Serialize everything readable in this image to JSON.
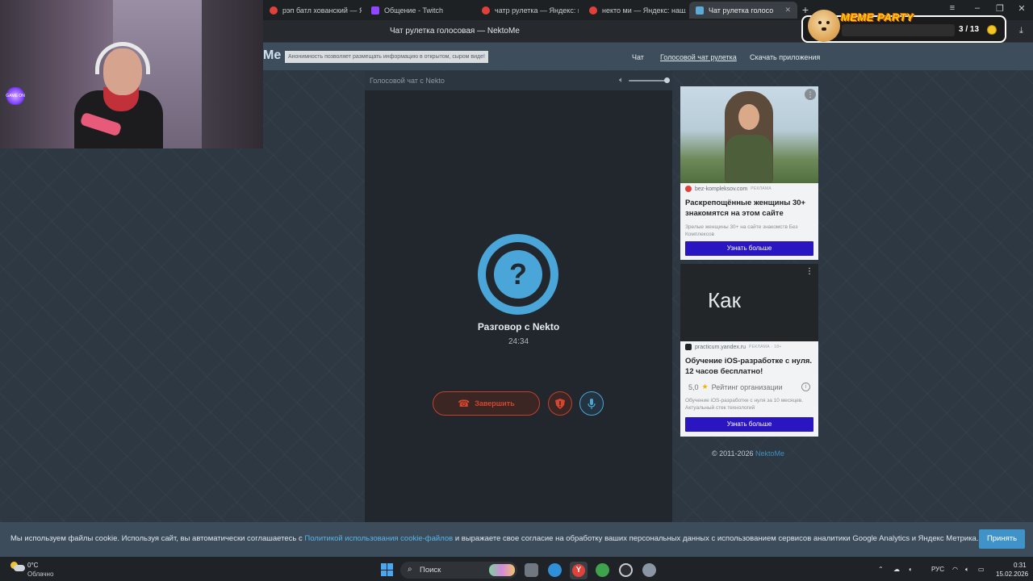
{
  "browser": {
    "tabs": [
      {
        "label": "рэп батл хованский — Ян",
        "icon": "yandex-icon",
        "active": false
      },
      {
        "label": "Общение - Twitch",
        "icon": "twitch-icon",
        "active": false
      },
      {
        "label": "чатр рулетка — Яндекс: н",
        "icon": "yandex-icon",
        "active": false
      },
      {
        "label": "некто ми — Яндекс: нашл",
        "icon": "yandex-icon",
        "active": false
      },
      {
        "label": "Чат рулетка голосо",
        "icon": "nekto-icon",
        "active": true
      }
    ],
    "page_title": "Чат рулетка голосовая — NektoMe"
  },
  "site": {
    "logo": "Me",
    "notice": "Анонимность позволяет размещать информацию в открытом, сыром виде!",
    "nav": [
      {
        "label": "Чат",
        "active": false
      },
      {
        "label": "Голосовой чат рулетка",
        "active": true
      },
      {
        "label": "Скачать приложения",
        "active": false
      }
    ]
  },
  "chat": {
    "header": "Голосовой чат с Nekto",
    "volume": 0.92,
    "avatar_glyph": "?",
    "title": "Разговор с Nekto",
    "timer": "24:34",
    "end_label": "Завершить"
  },
  "ads": [
    {
      "domain": "bez-kompleksov.com",
      "badge": "РЕКЛАМА",
      "title": "Раскрепощённые женщины 30+ знакомятся на этом сайте",
      "text": "Зрелые женщины 30+ на сайте знакомств Без Комплексов",
      "button": "Узнать больше"
    },
    {
      "image_text": "Как",
      "domain": "practicum.yandex.ru",
      "badge": "РЕКЛАМА · 18+",
      "title": "Обучение iOS-разработке с нуля. 12 часов бесплатно!",
      "rating": "5,0",
      "rating_label": "Рейтинг организации",
      "text": "Обучение iOS-разработке с нуля за 10 месяцев. Актуальный стек технологий",
      "button": "Узнать больше"
    }
  ],
  "footer": {
    "copyright": "© 2011-2026",
    "brand": "NektoMe"
  },
  "overlay": {
    "meme_title": "MEME PARTY",
    "meme_count": "3 / 13",
    "webcam_neon": "GAME ON"
  },
  "cookie": {
    "text_before": "Мы используем файлы cookie. Используя сайт, вы автоматически соглашаетесь с ",
    "link": "Политикой использования cookie-файлов",
    "text_after": " и выражаете свое согласие на обработку ваших персональных данных с использованием сервисов аналитики Google Analytics и Яндекс Метрика.",
    "accept": "Принять"
  },
  "taskbar": {
    "temperature": "0°C",
    "condition": "Облачно",
    "search": "Поиск",
    "lang": "РУС",
    "time": "0:31",
    "date": "15.02.2026"
  },
  "colors": {
    "accent_blue": "#4aa6d8",
    "end_red": "#d6452f",
    "ad_button": "#2a16c0",
    "link_blue": "#59b4e8"
  }
}
